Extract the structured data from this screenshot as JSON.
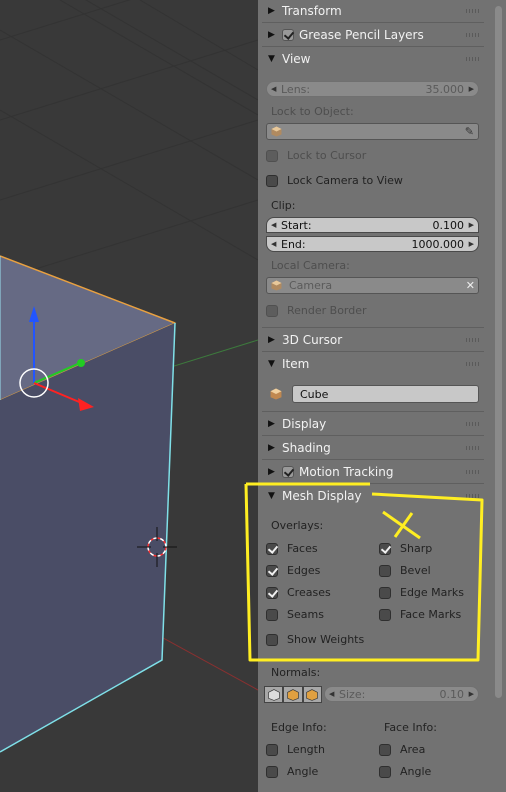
{
  "panels": {
    "transform": {
      "label": "Transform",
      "expanded": false
    },
    "grease_pencil": {
      "label": "Grease Pencil Layers",
      "expanded": false,
      "checked": true
    },
    "view": {
      "label": "View",
      "expanded": true
    },
    "cursor3d": {
      "label": "3D Cursor",
      "expanded": false
    },
    "item": {
      "label": "Item",
      "expanded": true
    },
    "display": {
      "label": "Display",
      "expanded": false
    },
    "shading": {
      "label": "Shading",
      "expanded": false
    },
    "motion_tracking": {
      "label": "Motion Tracking",
      "expanded": false,
      "checked": true
    },
    "mesh_display": {
      "label": "Mesh Display",
      "expanded": true
    }
  },
  "view": {
    "lens_label": "Lens:",
    "lens_value": "35.000",
    "lock_object_label": "Lock to Object:",
    "lock_cursor": "Lock to Cursor",
    "lock_camera": "Lock Camera to View",
    "clip_label": "Clip:",
    "clip_start_label": "Start:",
    "clip_start_value": "0.100",
    "clip_end_label": "End:",
    "clip_end_value": "1000.000",
    "local_camera_label": "Local Camera:",
    "camera_value": "Camera",
    "render_border": "Render Border"
  },
  "item": {
    "name": "Cube"
  },
  "mesh_display": {
    "overlays_label": "Overlays:",
    "faces": {
      "label": "Faces",
      "checked": true
    },
    "edges": {
      "label": "Edges",
      "checked": true
    },
    "creases": {
      "label": "Creases",
      "checked": true
    },
    "seams": {
      "label": "Seams",
      "checked": false
    },
    "show_weights": {
      "label": "Show Weights",
      "checked": false
    },
    "sharp": {
      "label": "Sharp",
      "checked": true
    },
    "bevel": {
      "label": "Bevel",
      "checked": false
    },
    "edge_marks": {
      "label": "Edge Marks",
      "checked": false
    },
    "face_marks": {
      "label": "Face Marks",
      "checked": false
    },
    "normals_label": "Normals:",
    "size_label": "Size:",
    "size_value": "0.10",
    "edge_info_label": "Edge Info:",
    "face_info_label": "Face Info:",
    "edge_length": {
      "label": "Length",
      "checked": false
    },
    "edge_angle": {
      "label": "Angle",
      "checked": false
    },
    "face_area": {
      "label": "Area",
      "checked": false
    },
    "face_angle": {
      "label": "Angle",
      "checked": false
    }
  },
  "colors": {
    "annotation": "#ffee22",
    "panel_bg": "#727272",
    "viewport_bg": "#393939"
  }
}
